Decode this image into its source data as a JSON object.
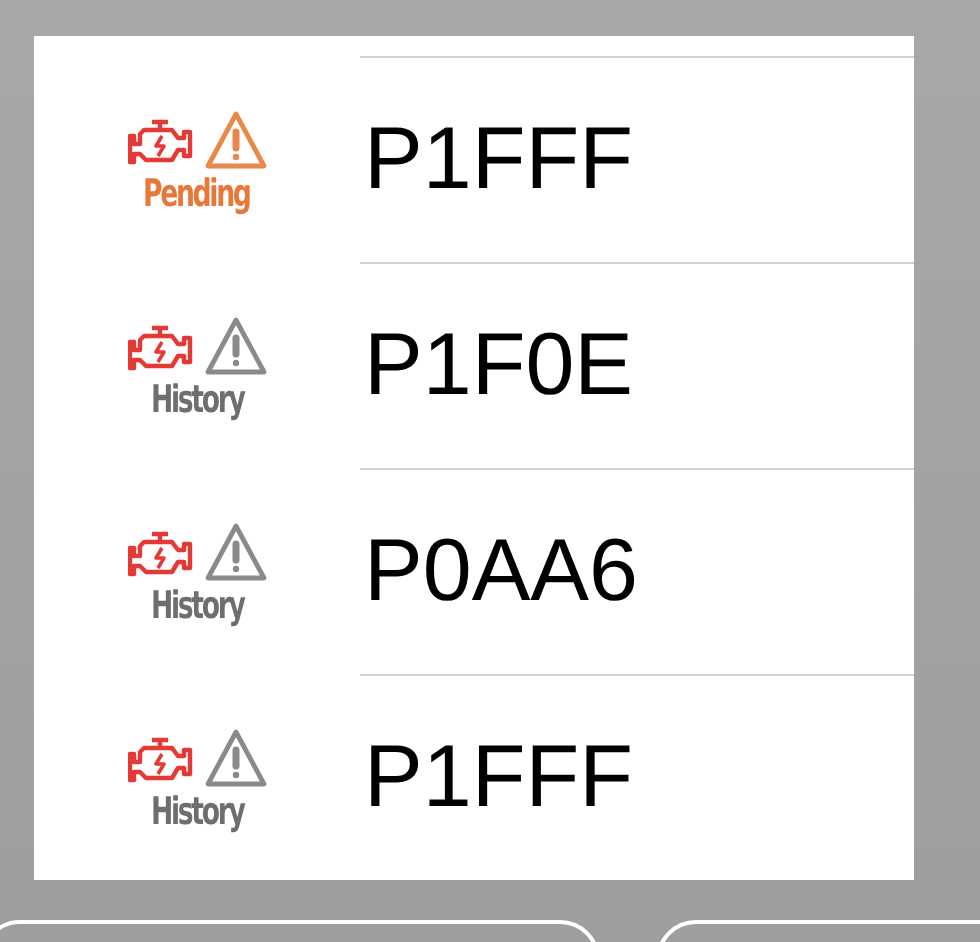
{
  "codes": [
    {
      "status": "Pending",
      "kind": "pending",
      "code": "P1FFF"
    },
    {
      "status": "History",
      "kind": "history",
      "code": "P1F0E"
    },
    {
      "status": "History",
      "kind": "history",
      "code": "P0AA6"
    },
    {
      "status": "History",
      "kind": "history",
      "code": "P1FFF"
    }
  ]
}
